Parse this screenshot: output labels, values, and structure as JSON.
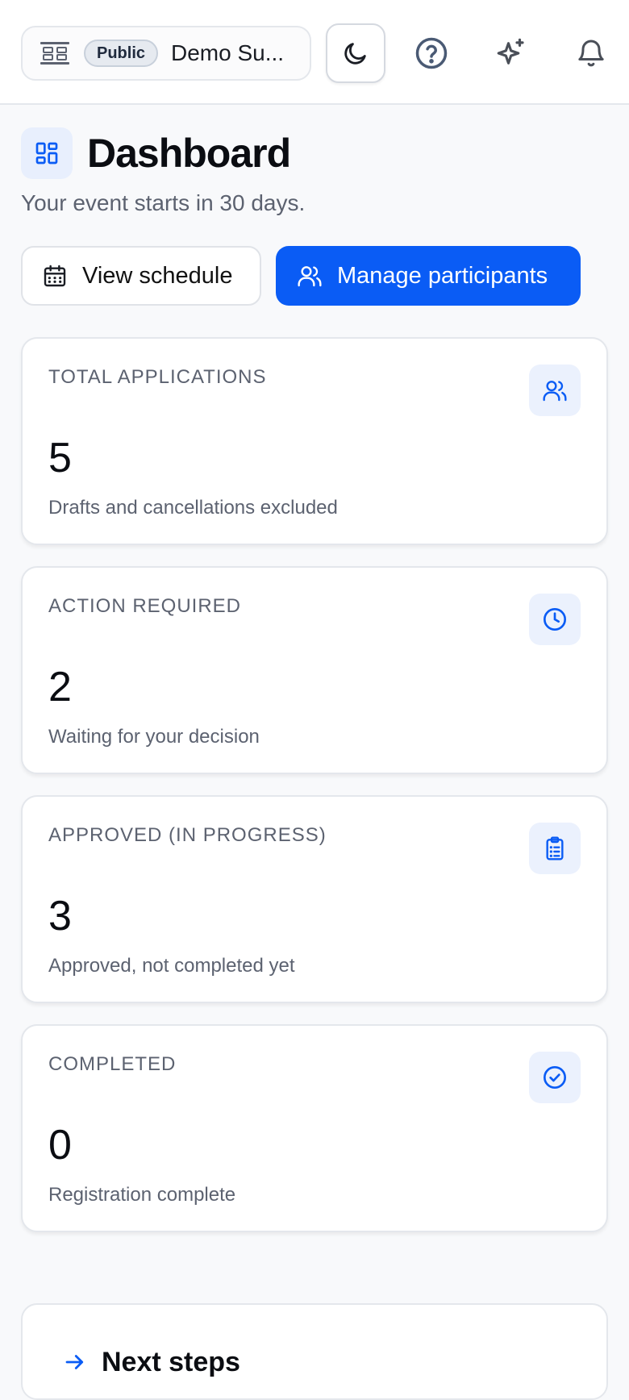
{
  "topbar": {
    "visibility_badge": "Public",
    "event_name": "Demo Su..."
  },
  "header": {
    "title": "Dashboard",
    "subtitle": "Your event starts in 30 days."
  },
  "actions": {
    "view_schedule": "View schedule",
    "manage_participants": "Manage participants"
  },
  "stats": [
    {
      "label": "TOTAL APPLICATIONS",
      "value": "5",
      "desc": "Drafts and cancellations excluded",
      "icon": "users-icon"
    },
    {
      "label": "ACTION REQUIRED",
      "value": "2",
      "desc": "Waiting for your decision",
      "icon": "clock-icon"
    },
    {
      "label": "APPROVED (IN PROGRESS)",
      "value": "3",
      "desc": "Approved, not completed yet",
      "icon": "clipboard-list-icon"
    },
    {
      "label": "COMPLETED",
      "value": "0",
      "desc": "Registration complete",
      "icon": "check-circle-icon"
    }
  ],
  "next_steps": {
    "title": "Next steps"
  },
  "colors": {
    "primary": "#0a5cf5",
    "icon_bg": "#ebf1fd",
    "muted_text": "#5c6270"
  }
}
